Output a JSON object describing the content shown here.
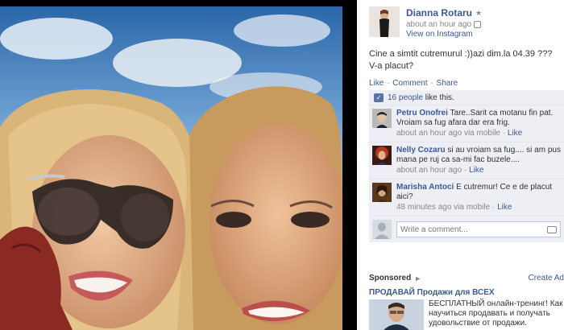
{
  "post": {
    "author": "Dianna Rotaru",
    "time": "about an hour ago",
    "via": "View on Instagram",
    "caption": "Cine a simtit cutremurul :))azi dim.la 04.39 ??? V-a placut?",
    "actions": {
      "like": "Like",
      "comment": "Comment",
      "share": "Share"
    }
  },
  "feedback": {
    "likes_count": "16 people",
    "likes_suffix": " like this."
  },
  "comments": [
    {
      "author": "Petru Onofrei",
      "text": "Tare..Sarit ca motanu fin pat. Vroiam sa fug afara dar era frig.",
      "time": "about an hour ago via mobile",
      "like": "Like"
    },
    {
      "author": "Nelly Cozaru",
      "text": "si au vroiam sa fug.... si am pus mana pe ruj ca sa-mi fac buzele....",
      "time": "about an hour ago",
      "like": "Like"
    },
    {
      "author": "Marisha Antoci",
      "text": "E cutremur! Ce e de placut aici?",
      "time": "48 minutes ago via mobile",
      "like": "Like"
    }
  ],
  "write_comment": {
    "placeholder": "Write a comment..."
  },
  "sponsored": {
    "label": "Sponsored",
    "create_ad": "Create Ad",
    "ad_title": "ПРОДАВАЙ Продажи для ВСЕХ",
    "ad_text": "БЕСПЛАТНЫЙ онлайн-тренинг! Как научиться продавать и получать удовольствие от продажи."
  },
  "colors": {
    "link": "#3b5998",
    "comment_bg": "#edeff4",
    "stage_bg": "#000000"
  },
  "icons": {
    "author_privacy": "friends-icon",
    "time_source": "instagram-icon",
    "likes": "thumbs-up-icon",
    "camera": "camera-icon",
    "sponsored": "megaphone-icon"
  }
}
